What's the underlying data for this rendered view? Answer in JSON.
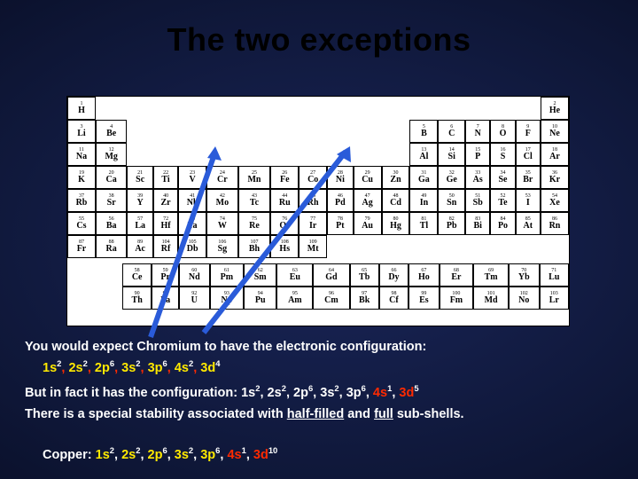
{
  "title": "The two exceptions",
  "text": {
    "expect": "You would expect Chromium to have the electronic configuration:",
    "butinfact_pre": "But in fact it has the configuration: ",
    "stability_1": "There is a special stability associated with ",
    "stability_half": "half-filled",
    "stability_and": " and ",
    "stability_full": "full",
    "stability_2": " sub-shells.",
    "copper_label": "Copper: "
  },
  "cfg_expected": [
    {
      "t": "1s2",
      "c": "yl"
    },
    {
      "t": "2s2",
      "c": "yl"
    },
    {
      "t": "2p6",
      "c": "yl"
    },
    {
      "t": "3s2",
      "c": "yl"
    },
    {
      "t": "3p6",
      "c": "yl"
    },
    {
      "t": "4s2",
      "c": "yl"
    },
    {
      "t": "3d4",
      "c": "yl"
    }
  ],
  "cfg_actual": [
    {
      "t": "1s2",
      "c": "wt"
    },
    {
      "t": "2s2",
      "c": "wt"
    },
    {
      "t": "2p6",
      "c": "wt"
    },
    {
      "t": "3s2",
      "c": "wt"
    },
    {
      "t": "3p6",
      "c": "wt"
    },
    {
      "t": "4s1",
      "c": "rd2"
    },
    {
      "t": "3d5",
      "c": "rd2"
    }
  ],
  "cfg_copper": [
    {
      "t": "1s2",
      "c": "yl"
    },
    {
      "t": "2s2",
      "c": "yl"
    },
    {
      "t": "2p6",
      "c": "yl"
    },
    {
      "t": "3s2",
      "c": "yl"
    },
    {
      "t": "3p6",
      "c": "yl"
    },
    {
      "t": "4s1",
      "c": "rd2"
    },
    {
      "t": "3d10",
      "c": "rd2"
    }
  ],
  "periodic_main": [
    [
      {
        "n": 1,
        "s": "H"
      },
      null,
      null,
      null,
      null,
      null,
      null,
      null,
      null,
      null,
      null,
      null,
      null,
      null,
      null,
      null,
      null,
      {
        "n": 2,
        "s": "He"
      }
    ],
    [
      {
        "n": 3,
        "s": "Li"
      },
      {
        "n": 4,
        "s": "Be"
      },
      null,
      null,
      null,
      null,
      null,
      null,
      null,
      null,
      null,
      null,
      {
        "n": 5,
        "s": "B"
      },
      {
        "n": 6,
        "s": "C"
      },
      {
        "n": 7,
        "s": "N"
      },
      {
        "n": 8,
        "s": "O"
      },
      {
        "n": 9,
        "s": "F"
      },
      {
        "n": 10,
        "s": "Ne"
      }
    ],
    [
      {
        "n": 11,
        "s": "Na"
      },
      {
        "n": 12,
        "s": "Mg"
      },
      null,
      null,
      null,
      null,
      null,
      null,
      null,
      null,
      null,
      null,
      {
        "n": 13,
        "s": "Al"
      },
      {
        "n": 14,
        "s": "Si"
      },
      {
        "n": 15,
        "s": "P"
      },
      {
        "n": 16,
        "s": "S"
      },
      {
        "n": 17,
        "s": "Cl"
      },
      {
        "n": 18,
        "s": "Ar"
      }
    ],
    [
      {
        "n": 19,
        "s": "K"
      },
      {
        "n": 20,
        "s": "Ca"
      },
      {
        "n": 21,
        "s": "Sc"
      },
      {
        "n": 22,
        "s": "Ti"
      },
      {
        "n": 23,
        "s": "V"
      },
      {
        "n": 24,
        "s": "Cr"
      },
      {
        "n": 25,
        "s": "Mn"
      },
      {
        "n": 26,
        "s": "Fe"
      },
      {
        "n": 27,
        "s": "Co"
      },
      {
        "n": 28,
        "s": "Ni"
      },
      {
        "n": 29,
        "s": "Cu"
      },
      {
        "n": 30,
        "s": "Zn"
      },
      {
        "n": 31,
        "s": "Ga"
      },
      {
        "n": 32,
        "s": "Ge"
      },
      {
        "n": 33,
        "s": "As"
      },
      {
        "n": 34,
        "s": "Se"
      },
      {
        "n": 35,
        "s": "Br"
      },
      {
        "n": 36,
        "s": "Kr"
      }
    ],
    [
      {
        "n": 37,
        "s": "Rb"
      },
      {
        "n": 38,
        "s": "Sr"
      },
      {
        "n": 39,
        "s": "Y"
      },
      {
        "n": 40,
        "s": "Zr"
      },
      {
        "n": 41,
        "s": "Nb"
      },
      {
        "n": 42,
        "s": "Mo"
      },
      {
        "n": 43,
        "s": "Tc"
      },
      {
        "n": 44,
        "s": "Ru"
      },
      {
        "n": 45,
        "s": "Rh"
      },
      {
        "n": 46,
        "s": "Pd"
      },
      {
        "n": 47,
        "s": "Ag"
      },
      {
        "n": 48,
        "s": "Cd"
      },
      {
        "n": 49,
        "s": "In"
      },
      {
        "n": 50,
        "s": "Sn"
      },
      {
        "n": 51,
        "s": "Sb"
      },
      {
        "n": 52,
        "s": "Te"
      },
      {
        "n": 53,
        "s": "I"
      },
      {
        "n": 54,
        "s": "Xe"
      }
    ],
    [
      {
        "n": 55,
        "s": "Cs"
      },
      {
        "n": 56,
        "s": "Ba"
      },
      {
        "n": 57,
        "s": "La"
      },
      {
        "n": 72,
        "s": "Hf"
      },
      {
        "n": 73,
        "s": "Ta"
      },
      {
        "n": 74,
        "s": "W"
      },
      {
        "n": 75,
        "s": "Re"
      },
      {
        "n": 76,
        "s": "Os"
      },
      {
        "n": 77,
        "s": "Ir"
      },
      {
        "n": 78,
        "s": "Pt"
      },
      {
        "n": 79,
        "s": "Au"
      },
      {
        "n": 80,
        "s": "Hg"
      },
      {
        "n": 81,
        "s": "Tl"
      },
      {
        "n": 82,
        "s": "Pb"
      },
      {
        "n": 83,
        "s": "Bi"
      },
      {
        "n": 84,
        "s": "Po"
      },
      {
        "n": 85,
        "s": "At"
      },
      {
        "n": 86,
        "s": "Rn"
      }
    ],
    [
      {
        "n": 87,
        "s": "Fr"
      },
      {
        "n": 88,
        "s": "Ra"
      },
      {
        "n": 89,
        "s": "Ac"
      },
      {
        "n": 104,
        "s": "Rf"
      },
      {
        "n": 105,
        "s": "Db"
      },
      {
        "n": 106,
        "s": "Sg"
      },
      {
        "n": 107,
        "s": "Bh"
      },
      {
        "n": 108,
        "s": "Hs"
      },
      {
        "n": 109,
        "s": "Mt"
      },
      null,
      null,
      null,
      null,
      null,
      null,
      null,
      null,
      null
    ]
  ],
  "periodic_f": [
    [
      {
        "n": 58,
        "s": "Ce"
      },
      {
        "n": 59,
        "s": "Pr"
      },
      {
        "n": 60,
        "s": "Nd"
      },
      {
        "n": 61,
        "s": "Pm"
      },
      {
        "n": 62,
        "s": "Sm"
      },
      {
        "n": 63,
        "s": "Eu"
      },
      {
        "n": 64,
        "s": "Gd"
      },
      {
        "n": 65,
        "s": "Tb"
      },
      {
        "n": 66,
        "s": "Dy"
      },
      {
        "n": 67,
        "s": "Ho"
      },
      {
        "n": 68,
        "s": "Er"
      },
      {
        "n": 69,
        "s": "Tm"
      },
      {
        "n": 70,
        "s": "Yb"
      },
      {
        "n": 71,
        "s": "Lu"
      }
    ],
    [
      {
        "n": 90,
        "s": "Th"
      },
      {
        "n": 91,
        "s": "Pa"
      },
      {
        "n": 92,
        "s": "U"
      },
      {
        "n": 93,
        "s": "Np"
      },
      {
        "n": 94,
        "s": "Pu"
      },
      {
        "n": 95,
        "s": "Am"
      },
      {
        "n": 96,
        "s": "Cm"
      },
      {
        "n": 97,
        "s": "Bk"
      },
      {
        "n": 98,
        "s": "Cf"
      },
      {
        "n": 99,
        "s": "Es"
      },
      {
        "n": 100,
        "s": "Fm"
      },
      {
        "n": 101,
        "s": "Md"
      },
      {
        "n": 102,
        "s": "No"
      },
      {
        "n": 103,
        "s": "Lr"
      }
    ]
  ]
}
